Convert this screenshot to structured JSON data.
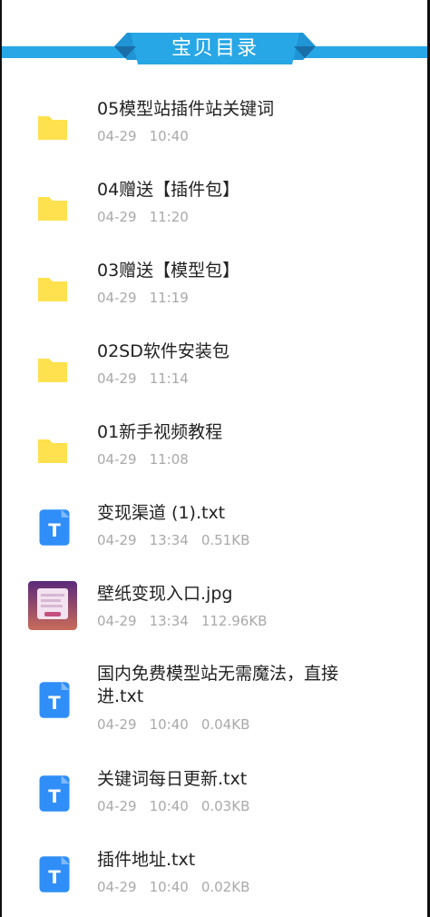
{
  "header": {
    "title": "宝贝目录",
    "accent": "#27a7e6"
  },
  "items": [
    {
      "type": "folder",
      "icon": "folder-icon",
      "name": "05模型站插件站关键词",
      "date": "04-29",
      "time": "10:40",
      "size": ""
    },
    {
      "type": "folder",
      "icon": "folder-icon",
      "name": "04赠送【插件包】",
      "date": "04-29",
      "time": "11:20",
      "size": ""
    },
    {
      "type": "folder",
      "icon": "folder-icon",
      "name": "03赠送【模型包】",
      "date": "04-29",
      "time": "11:19",
      "size": ""
    },
    {
      "type": "folder",
      "icon": "folder-icon",
      "name": "02SD软件安装包",
      "date": "04-29",
      "time": "11:14",
      "size": ""
    },
    {
      "type": "folder",
      "icon": "folder-icon",
      "name": "01新手视频教程",
      "date": "04-29",
      "time": "11:08",
      "size": ""
    },
    {
      "type": "txt",
      "icon": "text-file-icon",
      "name": "变现渠道 (1).txt",
      "date": "04-29",
      "time": "13:34",
      "size": "0.51KB"
    },
    {
      "type": "image",
      "icon": "image-thumbnail",
      "name": "壁纸变现入口.jpg",
      "date": "04-29",
      "time": "13:34",
      "size": "112.96KB"
    },
    {
      "type": "txt",
      "icon": "text-file-icon",
      "name_line1": "国内免费模型站无需魔法，直接",
      "name_line2": "进.txt",
      "date": "04-29",
      "time": "10:40",
      "size": "0.04KB"
    },
    {
      "type": "txt",
      "icon": "text-file-icon",
      "name": "关键词每日更新.txt",
      "date": "04-29",
      "time": "10:40",
      "size": "0.03KB"
    },
    {
      "type": "txt",
      "icon": "text-file-icon",
      "name": "插件地址.txt",
      "date": "04-29",
      "time": "10:40",
      "size": "0.02KB"
    }
  ]
}
